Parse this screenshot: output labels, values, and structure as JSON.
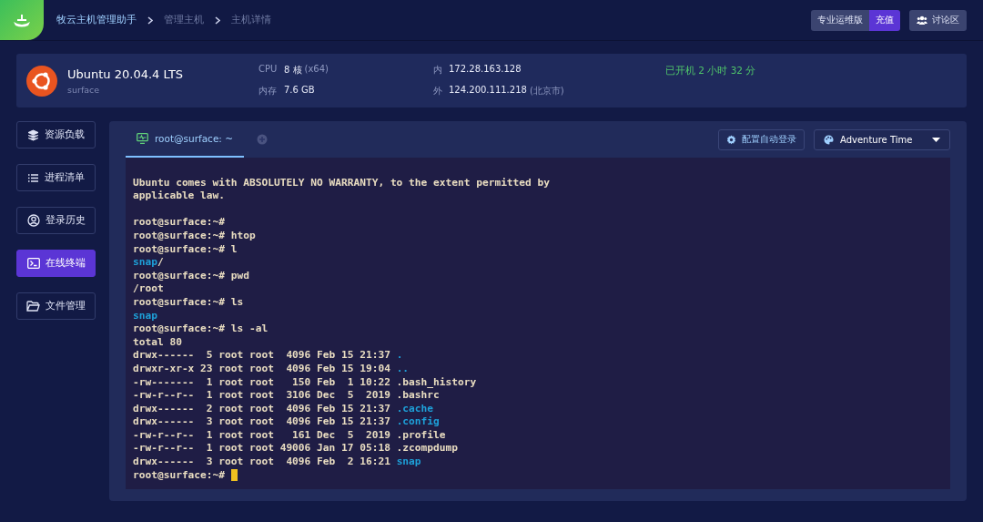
{
  "header": {
    "breadcrumb": [
      "牧云主机管理助手",
      "管理主机",
      "主机详情"
    ],
    "edition": "专业运维版",
    "recharge": "充值",
    "forum": "讨论区"
  },
  "host": {
    "os": "Ubuntu 20.04.4 LTS",
    "hostname": "surface",
    "cpu_label": "CPU",
    "cpu_value": "8 核",
    "cpu_arch": "(x64)",
    "mem_label": "内存",
    "mem_value": "7.6 GB",
    "inner_label": "内",
    "inner_ip": "172.28.163.128",
    "outer_label": "外",
    "outer_ip": "124.200.111.218",
    "outer_location": "(北京市)",
    "uptime": "已开机 2 小时 32 分"
  },
  "sidebar": {
    "items": [
      {
        "label": "资源负载",
        "kind": "layers",
        "selected": false
      },
      {
        "label": "进程清单",
        "kind": "list",
        "selected": false
      },
      {
        "label": "登录历史",
        "kind": "user",
        "selected": false
      },
      {
        "label": "在线终端",
        "kind": "terminal",
        "selected": true
      },
      {
        "label": "文件管理",
        "kind": "folder",
        "selected": false
      }
    ]
  },
  "tabs": [
    {
      "label": "root@surface: ~",
      "selected": true
    }
  ],
  "auto_login": "配置自动登录",
  "theme_select": {
    "value": "Adventure Time"
  },
  "terminal": {
    "blocks": [
      [
        [
          {
            "text": "Ubuntu comes with ABSOLUTELY NO WARRANTY, to the extent permitted by",
            "kind": "plain"
          }
        ],
        [
          {
            "text": "applicable law.",
            "kind": "plain"
          }
        ]
      ],
      [
        [
          {
            "text": "root@surface:~#",
            "kind": "plain"
          }
        ],
        [
          {
            "text": "root@surface:~# htop",
            "kind": "plain"
          }
        ],
        [
          {
            "text": "root@surface:~# l",
            "kind": "plain"
          }
        ],
        [
          {
            "text": "snap",
            "kind": "dir"
          },
          {
            "text": "/",
            "kind": "plain"
          }
        ],
        [
          {
            "text": "root@surface:~# pwd",
            "kind": "plain"
          }
        ],
        [
          {
            "text": "/root",
            "kind": "plain"
          }
        ],
        [
          {
            "text": "root@surface:~# ls",
            "kind": "plain"
          }
        ],
        [
          {
            "text": "snap",
            "kind": "dir"
          }
        ],
        [
          {
            "text": "root@surface:~# ls -al",
            "kind": "plain"
          }
        ],
        [
          {
            "text": "total 80",
            "kind": "plain"
          }
        ],
        [
          {
            "text": "drwx------  5 root root  4096 Feb 15 21:37 ",
            "kind": "plain"
          },
          {
            "text": ".",
            "kind": "dir"
          }
        ],
        [
          {
            "text": "drwxr-xr-x 23 root root  4096 Feb 15 19:04 ",
            "kind": "plain"
          },
          {
            "text": "..",
            "kind": "dir"
          }
        ],
        [
          {
            "text": "-rw-------  1 root root   150 Feb  1 10:22 .bash_history",
            "kind": "plain"
          }
        ],
        [
          {
            "text": "-rw-r--r--  1 root root  3106 Dec  5  2019 .bashrc",
            "kind": "plain"
          }
        ],
        [
          {
            "text": "drwx------  2 root root  4096 Feb 15 21:37 ",
            "kind": "plain"
          },
          {
            "text": ".cache",
            "kind": "dir"
          }
        ],
        [
          {
            "text": "drwx------  3 root root  4096 Feb 15 21:37 ",
            "kind": "plain"
          },
          {
            "text": ".config",
            "kind": "dir"
          }
        ],
        [
          {
            "text": "-rw-r--r--  1 root root   161 Dec  5  2019 .profile",
            "kind": "plain"
          }
        ],
        [
          {
            "text": "-rw-r--r--  1 root root 49006 Jan 17 05:18 .zcompdump",
            "kind": "plain"
          }
        ],
        [
          {
            "text": "drwx------  3 root root  4096 Feb  2 16:21 ",
            "kind": "plain"
          },
          {
            "text": "snap",
            "kind": "dir"
          }
        ]
      ]
    ],
    "prompt": "root@surface:~# "
  }
}
